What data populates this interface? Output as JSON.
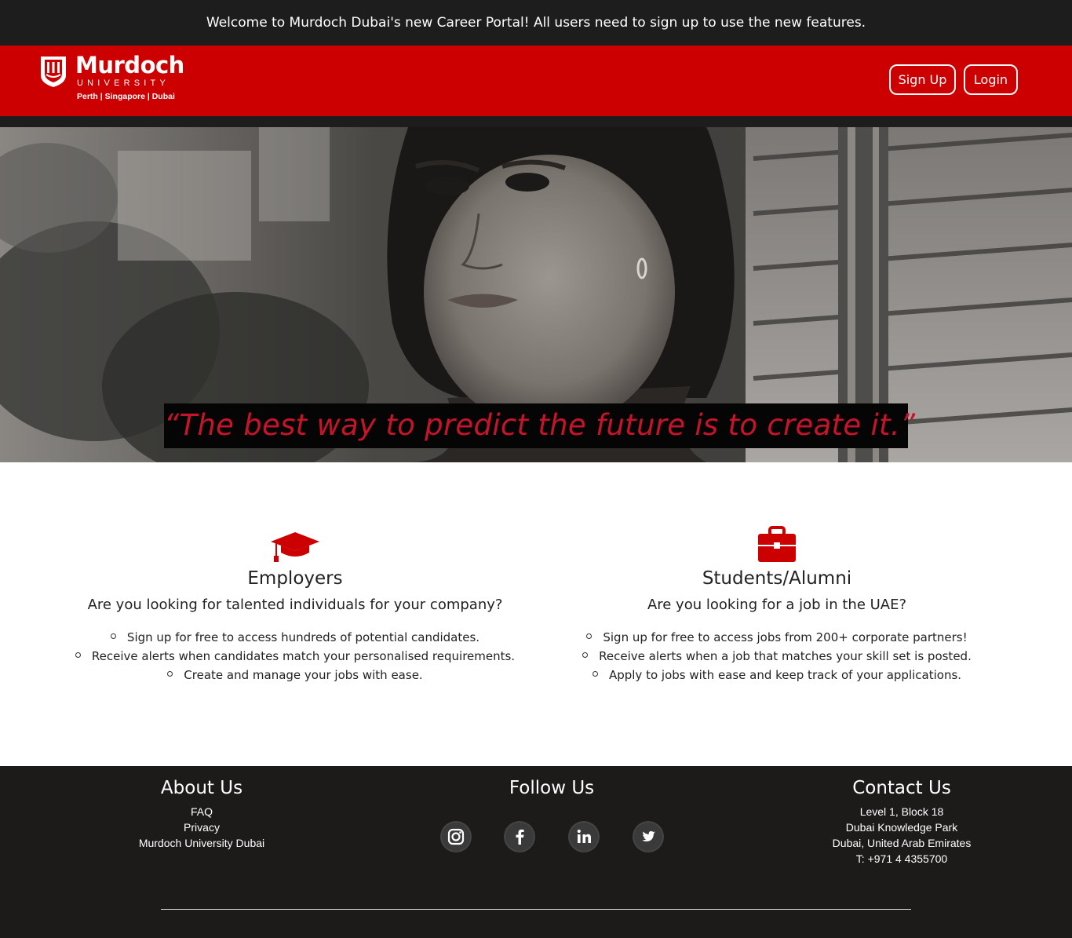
{
  "announcement": "Welcome to Murdoch Dubai's new Career Portal! All users need to sign up to use the new features.",
  "brand": {
    "name": "Murdoch",
    "subtitle": "UNIVERSITY",
    "campuses": "Perth | Singapore | Dubai",
    "header_color": "#cc0000"
  },
  "nav": {
    "signup_label": "Sign Up",
    "login_label": "Login"
  },
  "hero": {
    "quote": "“The best way to predict the future is to create it.”",
    "quote_color": "#c8142a"
  },
  "employers": {
    "icon": "graduation-cap-icon",
    "title": "Employers",
    "question": "Are you looking for talented individuals for your company?",
    "points": [
      "Sign up for free to access hundreds of potential candidates.",
      "Receive alerts when candidates match your personalised requirements.",
      "Create and manage your jobs with ease."
    ]
  },
  "students": {
    "icon": "briefcase-icon",
    "title": "Students/Alumni",
    "question": "Are you looking for a job in the UAE?",
    "points": [
      "Sign up for free to access jobs from 200+ corporate partners!",
      "Receive alerts when a job that matches your skill set is posted.",
      "Apply to jobs with ease and keep track of your applications."
    ]
  },
  "footer": {
    "about": {
      "title": "About Us",
      "links": [
        "FAQ",
        "Privacy",
        "Murdoch University Dubai"
      ]
    },
    "follow": {
      "title": "Follow Us",
      "icons": [
        "instagram-icon",
        "facebook-icon",
        "linkedin-icon",
        "twitter-icon"
      ]
    },
    "contact": {
      "title": "Contact Us",
      "lines": [
        "Level 1, Block 18",
        "Dubai Knowledge Park",
        "Dubai, United Arab Emirates",
        "T: +971 4 4355700"
      ]
    }
  }
}
